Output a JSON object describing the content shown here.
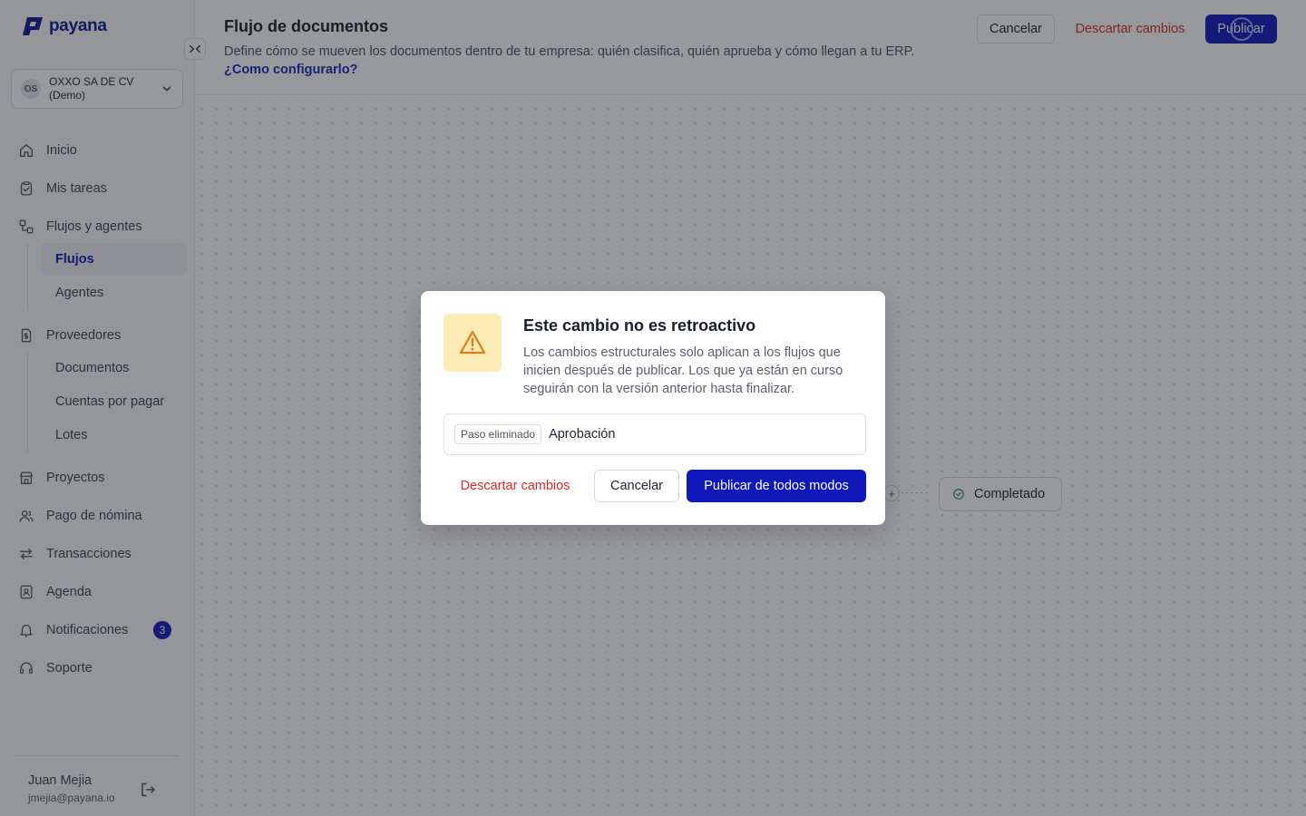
{
  "brand": {
    "name": "payana",
    "primary_color": "#1118b8",
    "danger_color": "#d92a2a",
    "warning_bg": "#fdebb6"
  },
  "company": {
    "initials": "OS",
    "name": "OXXO SA DE CV (Demo)"
  },
  "nav": {
    "inicio": "Inicio",
    "mis_tareas": "Mis tareas",
    "flujos_agentes": "Flujos y agentes",
    "flujos": "Flujos",
    "agentes": "Agentes",
    "proveedores": "Proveedores",
    "documentos": "Documentos",
    "cuentas_por_pagar": "Cuentas por pagar",
    "lotes": "Lotes",
    "proyectos": "Proyectos",
    "pago_nomina": "Pago de nómina",
    "transacciones": "Transacciones",
    "agenda": "Agenda",
    "notificaciones": "Notificaciones",
    "notificaciones_count": "3",
    "soporte": "Soporte"
  },
  "user": {
    "name": "Juan Mejia",
    "email": "jmejia@payana.io"
  },
  "header": {
    "title": "Flujo de documentos",
    "description": "Define cómo se mueven los documentos dentro de tu empresa: quién clasifica, quién aprueba y cómo llegan a tu ERP.",
    "help_link": "¿Como configurarlo?",
    "cancel": "Cancelar",
    "discard": "Descartar cambios",
    "publish": "Publicar"
  },
  "flow": {
    "plus": "+",
    "completed_node": "Completado"
  },
  "dialog": {
    "title": "Este cambio no es retroactivo",
    "body": "Los cambios estructurales solo aplican a los flujos que inicien después de publicar. Los que ya están en curso seguirán con la versión anterior hasta finalizar.",
    "change_tag": "Paso eliminado",
    "change_name": "Aprobación",
    "discard": "Descartar cambios",
    "cancel": "Cancelar",
    "publish": "Publicar de todos modos"
  }
}
